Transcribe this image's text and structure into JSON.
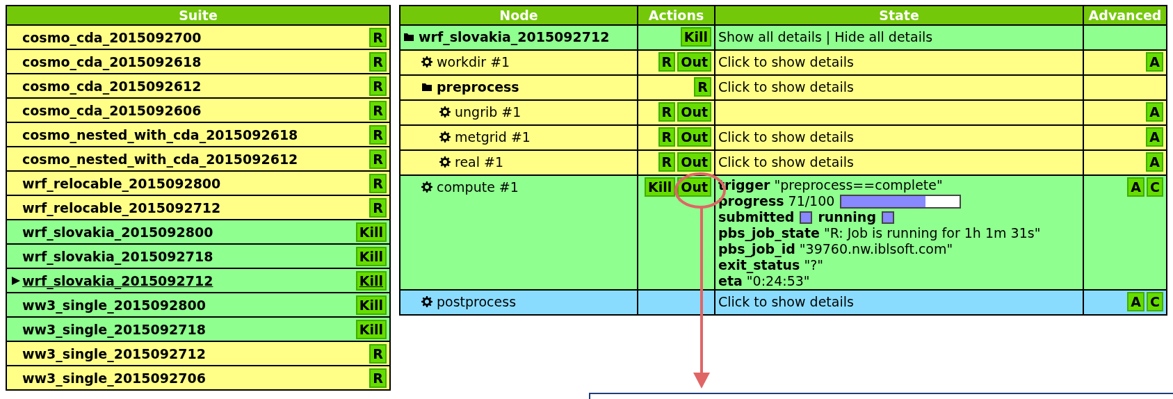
{
  "suite_table": {
    "header": "Suite",
    "rows": [
      {
        "name": "cosmo_cda_2015092700",
        "color": "#ffff88",
        "action": "R",
        "selected": false
      },
      {
        "name": "cosmo_cda_2015092618",
        "color": "#ffff88",
        "action": "R",
        "selected": false
      },
      {
        "name": "cosmo_cda_2015092612",
        "color": "#ffff88",
        "action": "R",
        "selected": false
      },
      {
        "name": "cosmo_cda_2015092606",
        "color": "#ffff88",
        "action": "R",
        "selected": false
      },
      {
        "name": "cosmo_nested_with_cda_2015092618",
        "color": "#ffff88",
        "action": "R",
        "selected": false
      },
      {
        "name": "cosmo_nested_with_cda_2015092612",
        "color": "#ffff88",
        "action": "R",
        "selected": false
      },
      {
        "name": "wrf_relocable_2015092800",
        "color": "#ffff88",
        "action": "R",
        "selected": false
      },
      {
        "name": "wrf_relocable_2015092712",
        "color": "#ffff88",
        "action": "R",
        "selected": false
      },
      {
        "name": "wrf_slovakia_2015092800",
        "color": "#8fff8f",
        "action": "Kill",
        "selected": false
      },
      {
        "name": "wrf_slovakia_2015092718",
        "color": "#8fff8f",
        "action": "Kill",
        "selected": false
      },
      {
        "name": "wrf_slovakia_2015092712",
        "color": "#8fff8f",
        "action": "Kill",
        "selected": true
      },
      {
        "name": "ww3_single_2015092800",
        "color": "#8fff8f",
        "action": "Kill",
        "selected": false
      },
      {
        "name": "ww3_single_2015092718",
        "color": "#8fff8f",
        "action": "Kill",
        "selected": false
      },
      {
        "name": "ww3_single_2015092712",
        "color": "#ffff88",
        "action": "R",
        "selected": false
      },
      {
        "name": "ww3_single_2015092706",
        "color": "#ffff88",
        "action": "R",
        "selected": false
      }
    ]
  },
  "node_table": {
    "columns": [
      "Node",
      "Actions",
      "State",
      "Advanced"
    ],
    "tree": [
      {
        "name": "wrf_slovakia_2015092712",
        "kind": "family",
        "color": "#8fff8f",
        "actions": [
          "Kill"
        ],
        "state": {
          "kind": "links",
          "links": [
            "Show all details",
            "Hide all details"
          ],
          "separator": "|"
        },
        "children": [
          {
            "name": "workdir #1",
            "kind": "task",
            "color": "#ffff88",
            "actions": [
              "R",
              "Out"
            ],
            "state": {
              "kind": "hint",
              "text": "Click to show details"
            },
            "advanced": [
              "A"
            ]
          },
          {
            "name": "preprocess",
            "kind": "family",
            "color": "#ffff88",
            "actions": [
              "R"
            ],
            "state": {
              "kind": "hint",
              "text": "Click to show details"
            },
            "children": [
              {
                "name": "ungrib #1",
                "kind": "task",
                "color": "#ffff88",
                "actions": [
                  "R",
                  "Out"
                ],
                "advanced": [
                  "A"
                ]
              },
              {
                "name": "metgrid #1",
                "kind": "task",
                "color": "#ffff88",
                "actions": [
                  "R",
                  "Out"
                ],
                "state": {
                  "kind": "hint",
                  "text": "Click to show details"
                },
                "advanced": [
                  "A"
                ]
              },
              {
                "name": "real #1",
                "kind": "task",
                "color": "#ffff88",
                "actions": [
                  "R",
                  "Out"
                ],
                "state": {
                  "kind": "hint",
                  "text": "Click to show details"
                },
                "advanced": [
                  "A"
                ]
              }
            ]
          },
          {
            "name": "compute #1",
            "kind": "task",
            "color": "#8fff8f",
            "actions": [
              "Kill",
              "Out"
            ],
            "advanced": [
              "A",
              "C"
            ],
            "state": {
              "kind": "details",
              "lines": [
                {
                  "kind": "text",
                  "text": "**trigger** \"preprocess==complete\""
                },
                {
                  "kind": "progress",
                  "text": "**progress** 71/100",
                  "level": 0.71
                },
                {
                  "kind": "flags",
                  "flags": [
                    "submitted",
                    "running"
                  ]
                },
                {
                  "kind": "text",
                  "text": "**pbs_job_state** \"R: Job is running for 1h 1m 31s\""
                },
                {
                  "kind": "text",
                  "text": "**pbs_job_id** \"39760.nw.iblsoft.com\""
                },
                {
                  "kind": "text",
                  "text": "**exit_status** \"?\""
                },
                {
                  "kind": "text",
                  "text": "**eta** \"0:24:53\""
                }
              ]
            }
          },
          {
            "name": "postprocess",
            "kind": "task",
            "color": "#8adcff",
            "state": {
              "kind": "hint",
              "text": "Click to show details"
            },
            "advanced": [
              "A",
              "C"
            ]
          }
        ]
      }
    ]
  }
}
